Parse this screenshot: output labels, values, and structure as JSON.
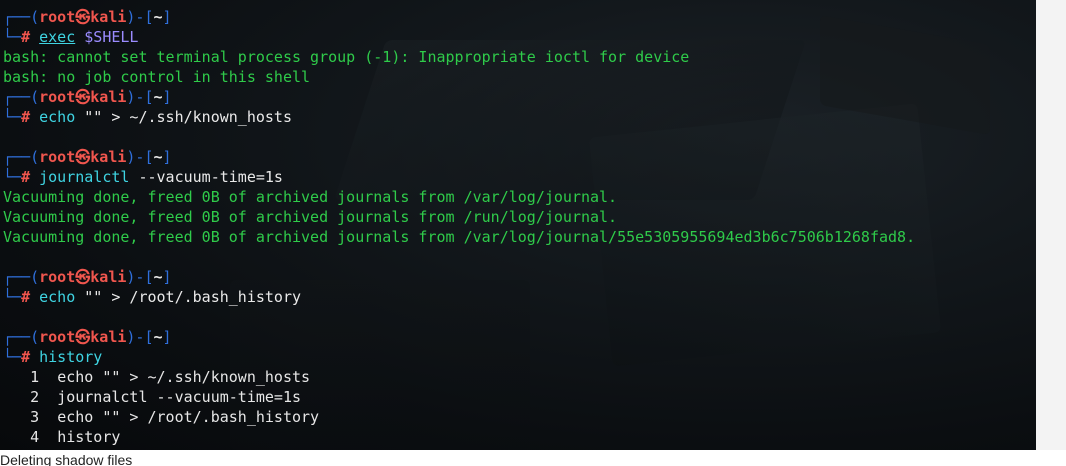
{
  "prompt": {
    "user": "root",
    "host": "kali",
    "dir": "~",
    "at_symbol": "㉿",
    "hash": "#"
  },
  "blocks": [
    {
      "command_parts": [
        {
          "text": "exec",
          "style": "cmd-u"
        },
        {
          "text": " ",
          "style": "arg"
        },
        {
          "text": "$SHELL",
          "style": "var"
        }
      ],
      "output": [
        "bash: cannot set terminal process group (-1): Inappropriate ioctl for device",
        "bash: no job control in this shell"
      ]
    },
    {
      "command_parts": [
        {
          "text": "echo",
          "style": "cmd"
        },
        {
          "text": " \"\" > ~/.ssh/known_hosts",
          "style": "arg"
        }
      ],
      "output": [],
      "blank_after": true
    },
    {
      "command_parts": [
        {
          "text": "journalctl",
          "style": "cmd"
        },
        {
          "text": " --vacuum-time=1s",
          "style": "arg"
        }
      ],
      "output": [
        "Vacuuming done, freed 0B of archived journals from /var/log/journal.",
        "Vacuuming done, freed 0B of archived journals from /run/log/journal.",
        "Vacuuming done, freed 0B of archived journals from /var/log/journal/55e5305955694ed3b6c7506b1268fad8."
      ],
      "blank_after": true
    },
    {
      "command_parts": [
        {
          "text": "echo",
          "style": "cmd"
        },
        {
          "text": " \"\" > /root/.bash_history",
          "style": "arg"
        }
      ],
      "output": [],
      "blank_after": true
    },
    {
      "command_parts": [
        {
          "text": "history",
          "style": "cmd"
        }
      ],
      "history": [
        {
          "num": "1",
          "text": "echo \"\" > ~/.ssh/known_hosts"
        },
        {
          "num": "2",
          "text": "journalctl --vacuum-time=1s"
        },
        {
          "num": "3",
          "text": "echo \"\" > /root/.bash_history"
        },
        {
          "num": "4",
          "text": "history"
        }
      ]
    }
  ],
  "caption": "Deleting shadow files"
}
